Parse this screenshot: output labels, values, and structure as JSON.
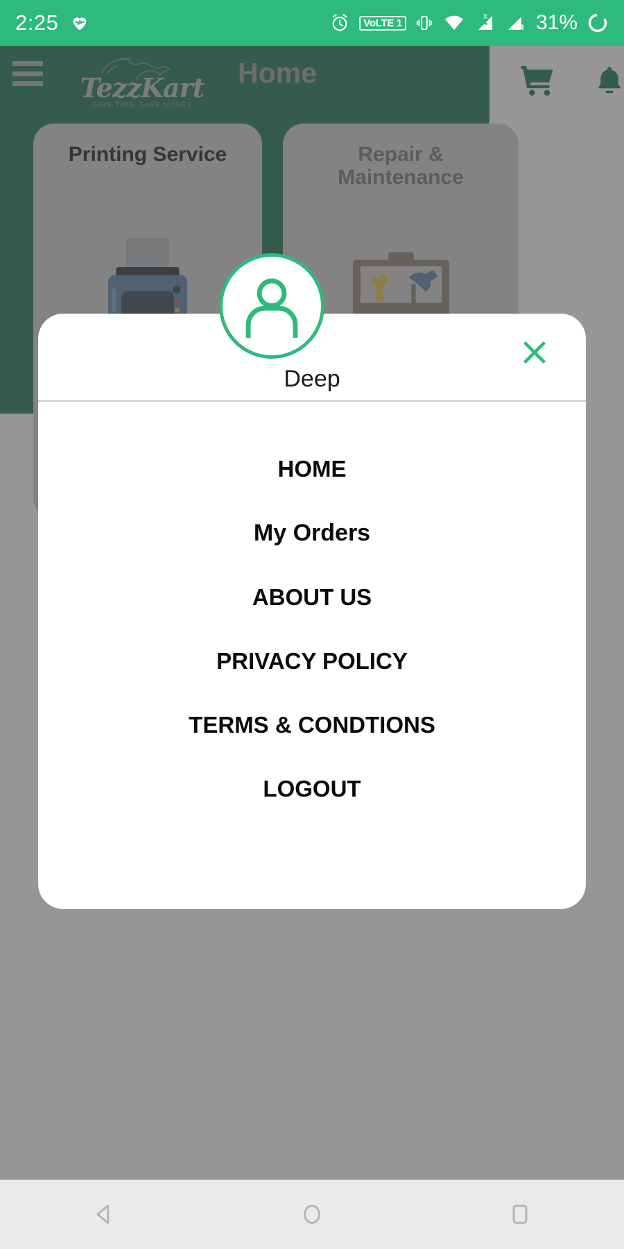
{
  "status_bar": {
    "time": "2:25",
    "battery_percent": "31%",
    "icons": [
      "heart-rate-icon",
      "alarm-icon",
      "volte1-badge",
      "vibrate-icon",
      "wifi-icon",
      "signal-sim1-icon",
      "signal-sim2-roaming-icon",
      "battery-charging-icon"
    ],
    "volte_label": "VoLTE 1",
    "roaming_label": "R",
    "sim_label": "X",
    "background_color": "#2DBA7C"
  },
  "header": {
    "title": "Home",
    "menu_icon": "hamburger-menu-icon",
    "cart_icon": "shopping-cart-icon",
    "bell_icon": "notification-bell-icon",
    "logo": {
      "word": "TezzKart",
      "tagline": "SAVE TIME, SAVE MONEY",
      "mark": "running-horse-icon"
    },
    "background_color": "#0E6B48"
  },
  "home_cards": [
    {
      "title": "Printing Service",
      "icon": "printer-illustration"
    },
    {
      "title": "Repair &\nMaintenance",
      "title_line1": "Repair &",
      "title_line2": "Maintenance",
      "icon": "toolbox-illustration"
    }
  ],
  "dialog": {
    "profile_name": "Deep",
    "avatar_icon": "user-avatar-icon",
    "close_icon": "close-x-icon",
    "accent_color": "#2DBA7C",
    "menu_items": [
      {
        "label": "HOME"
      },
      {
        "label": "My Orders"
      },
      {
        "label": "ABOUT US"
      },
      {
        "label": "PRIVACY POLICY"
      },
      {
        "label": "TERMS & CONDTIONS"
      },
      {
        "label": "LOGOUT"
      }
    ]
  },
  "navigation_bar": {
    "back": "back-triangle-icon",
    "home": "home-circle-icon",
    "recents": "recents-square-icon"
  }
}
